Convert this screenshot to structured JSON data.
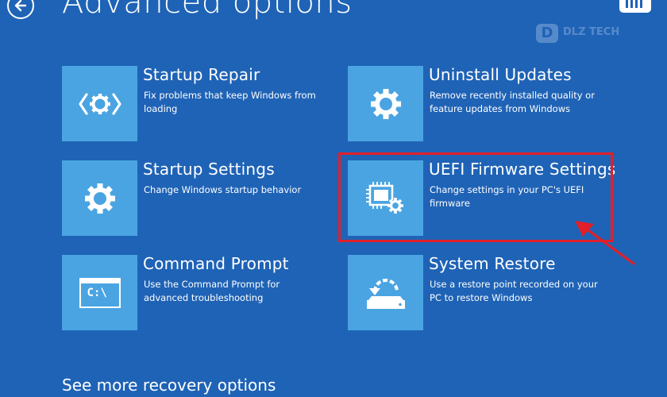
{
  "header": {
    "title": "Advanced options"
  },
  "watermark": {
    "logo_letter": "D",
    "text": "DLZ TECH"
  },
  "options": [
    {
      "title": "Startup Repair",
      "description": "Fix problems that keep Windows from loading",
      "icon": "startup-repair-icon"
    },
    {
      "title": "Uninstall Updates",
      "description": "Remove recently installed quality or feature updates from Windows",
      "icon": "gear-icon"
    },
    {
      "title": "Startup Settings",
      "description": "Change Windows startup behavior",
      "icon": "gear-icon"
    },
    {
      "title": "UEFI Firmware Settings",
      "description": "Change settings in your PC's UEFI firmware",
      "icon": "firmware-chip-gear-icon",
      "highlighted": true
    },
    {
      "title": "Command Prompt",
      "description": "Use the Command Prompt for advanced troubleshooting",
      "icon": "command-prompt-icon",
      "icon_text": "C:\\"
    },
    {
      "title": "System Restore",
      "description": "Use a restore point recorded on your PC to restore Windows",
      "icon": "system-restore-icon"
    }
  ],
  "footer": {
    "more_options_label": "See more recovery options"
  },
  "colors": {
    "background": "#1f63b6",
    "tile": "#4aa4e2",
    "highlight": "#e0202a",
    "text": "#ffffff"
  }
}
